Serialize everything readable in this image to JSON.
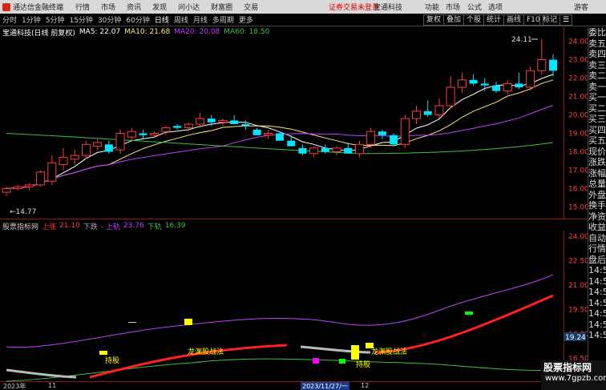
{
  "menubar": {
    "app_name": "通达信金融终端",
    "items": [
      "行情",
      "市场",
      "资讯",
      "发现",
      "问小达",
      "财富圈",
      "交易"
    ],
    "notice": "证券交易未登录",
    "broker": "宝通科技",
    "right_items": [
      "功能",
      "市场",
      "公式",
      "选项",
      "游客"
    ]
  },
  "toolbar": {
    "periods": [
      "分时",
      "1分钟",
      "5分钟",
      "15分钟",
      "30分钟",
      "60分钟",
      "日线",
      "周线",
      "月线",
      "多周期",
      "更多"
    ],
    "active_period": "日线",
    "right_buttons": [
      "复权",
      "叠加",
      "个股",
      "统计",
      "画线",
      "F10",
      "标记"
    ]
  },
  "main_chart": {
    "title": "宝通科技(日线 前复权)",
    "ma5": "MA5: 22.07",
    "ma10": "MA10: 21.68",
    "ma20": "MA20: 20.08",
    "ma60": "MA60: 18.50",
    "high_label": "24.11",
    "low_label": "14.77",
    "price_axis": [
      "24.00",
      "23.00",
      "22.00",
      "21.00",
      "20.00",
      "19.00",
      "18.00",
      "17.00",
      "16.00",
      "15.00"
    ]
  },
  "indicator": {
    "title": "股票指标网",
    "upper_label": "上涨",
    "upper_value": "21.10",
    "lower_label": "下跌",
    "mid_label": "- 上轨",
    "mid_value": "23.76",
    "down_label": "下轨",
    "down_value": "16.39",
    "axis": [
      "24.00",
      "22.50",
      "21.00",
      "19.50",
      "18.00",
      "16.50"
    ],
    "current": "19.24",
    "signals": [
      "持股",
      "龙渊股战法",
      "持股",
      "龙渊股战法"
    ]
  },
  "bottom": {
    "year": "2023年",
    "m1": "11",
    "date": "2023/11/27/一",
    "m2": "12"
  },
  "right_panel": [
    "委比",
    "卖五",
    "卖四",
    "卖三",
    "卖二",
    "卖一",
    "买一",
    "买二",
    "买三",
    "买四",
    "买五",
    "现价",
    "涨跌",
    "涨幅",
    "总量",
    "外盘",
    "换手",
    "净资",
    "收益",
    "自动",
    "行情",
    "盘后",
    "14:5",
    "14:5",
    "14:5",
    "14:5",
    "14:5",
    "14:5",
    "14:5"
  ],
  "watermark": {
    "line1": "股票指标网",
    "line2": "www.7gpzb.com"
  },
  "colors": {
    "up": "#ff3b3b",
    "down": "#00e5ff",
    "ma5": "#ffffff",
    "ma10": "#ffe680",
    "ma20": "#c040ff",
    "ma60": "#40c040"
  },
  "chart_data": {
    "type": "candlestick",
    "ylim": [
      14.5,
      24.5
    ],
    "candles": [
      [
        15.8,
        16.1,
        15.6,
        16.0
      ],
      [
        16.0,
        16.2,
        15.9,
        16.1
      ],
      [
        16.1,
        16.3,
        15.9,
        16.2
      ],
      [
        16.2,
        17.0,
        16.1,
        16.9
      ],
      [
        16.4,
        17.8,
        16.2,
        17.4
      ],
      [
        17.3,
        18.2,
        17.0,
        17.7
      ],
      [
        17.6,
        18.1,
        17.3,
        17.8
      ],
      [
        17.8,
        18.6,
        17.6,
        18.4
      ],
      [
        18.3,
        18.7,
        18.1,
        18.5
      ],
      [
        18.4,
        18.6,
        17.9,
        18.0
      ],
      [
        18.1,
        19.2,
        17.9,
        19.0
      ],
      [
        18.8,
        19.3,
        18.6,
        19.1
      ],
      [
        19.0,
        19.2,
        18.7,
        18.9
      ],
      [
        18.9,
        19.1,
        18.8,
        19.0
      ],
      [
        19.1,
        19.4,
        18.9,
        19.3
      ],
      [
        19.4,
        19.5,
        19.2,
        19.3
      ],
      [
        19.3,
        19.6,
        19.1,
        19.5
      ],
      [
        19.5,
        20.1,
        19.3,
        19.8
      ],
      [
        19.8,
        20.0,
        19.4,
        19.6
      ],
      [
        19.6,
        19.8,
        19.4,
        19.7
      ],
      [
        19.7,
        20.0,
        19.5,
        19.5
      ],
      [
        19.5,
        19.7,
        19.2,
        19.4
      ],
      [
        19.2,
        19.3,
        18.9,
        18.9
      ],
      [
        18.9,
        19.2,
        18.7,
        19.0
      ],
      [
        19.0,
        19.1,
        18.6,
        18.6
      ],
      [
        18.6,
        18.9,
        18.3,
        18.3
      ],
      [
        18.2,
        18.4,
        17.8,
        17.9
      ],
      [
        17.9,
        18.3,
        17.7,
        18.2
      ],
      [
        18.2,
        18.4,
        17.9,
        18.0
      ],
      [
        18.0,
        18.3,
        17.8,
        18.2
      ],
      [
        18.2,
        18.5,
        17.9,
        17.9
      ],
      [
        17.9,
        18.6,
        17.7,
        18.4
      ],
      [
        18.4,
        19.3,
        18.2,
        19.1
      ],
      [
        19.1,
        19.2,
        18.7,
        18.9
      ],
      [
        18.9,
        19.0,
        18.3,
        18.4
      ],
      [
        18.4,
        20.0,
        18.2,
        19.8
      ],
      [
        19.8,
        20.5,
        19.5,
        20.2
      ],
      [
        20.2,
        20.8,
        19.9,
        20.0
      ],
      [
        20.0,
        20.9,
        19.8,
        20.5
      ],
      [
        20.5,
        22.1,
        20.3,
        21.5
      ],
      [
        21.5,
        22.3,
        21.2,
        21.9
      ],
      [
        21.9,
        22.2,
        21.6,
        21.7
      ],
      [
        21.7,
        22.0,
        21.3,
        21.6
      ],
      [
        21.6,
        21.8,
        21.2,
        21.3
      ],
      [
        21.3,
        21.9,
        21.1,
        21.7
      ],
      [
        21.7,
        22.3,
        21.4,
        21.5
      ],
      [
        21.5,
        22.6,
        21.3,
        22.4
      ],
      [
        22.4,
        24.11,
        22.2,
        23.0
      ],
      [
        23.0,
        23.3,
        22.1,
        22.4
      ]
    ]
  }
}
